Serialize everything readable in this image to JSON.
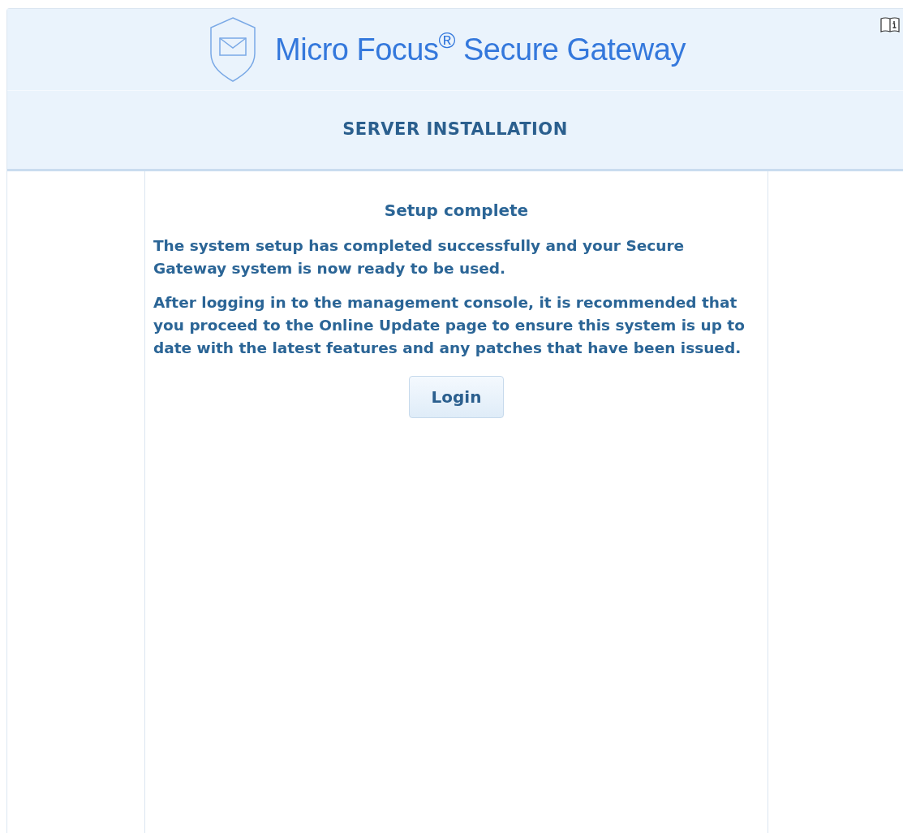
{
  "header": {
    "brand": "Micro Focus$^{®}$ Secure Gateway",
    "title": "SERVER INSTALLATION"
  },
  "content": {
    "heading": "Setup complete",
    "paragraphs": [
      "The system setup has completed successfully and your Secure Gateway system is now ready to be used.",
      "After logging in to the management console, it is recommended that you proceed to the Online Update page to ensure this system is up to date with the latest features and any patches that have been issued."
    ],
    "button": "Login"
  }
}
